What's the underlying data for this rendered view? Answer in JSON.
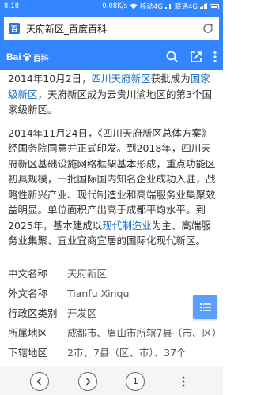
{
  "status_bar": {
    "time": "8:18",
    "speed": "0.08K/s",
    "carrier1": "移动4G",
    "carrier2": "联通4G"
  },
  "url_bar": {
    "site_icon_text": "百",
    "title": "天府新区_百度百科"
  },
  "header": {
    "logo_left": "Bai",
    "logo_right": "百科"
  },
  "article": {
    "paragraphs": [
      {
        "pre1": "2014年10月2日，",
        "link1": "四川天府新区",
        "mid1": "获批成为",
        "link2": "国家级新区",
        "post1": "，天府新区成为云贵川渝地区的第3个国家级新区。"
      },
      {
        "pre1": "2014年11月24日，《四川天府新区总体方案》经国务院同意并正式印发。到2018年，四川天府新区基础设施网络框架基本形成，重点功能区初具规模，一批国际国内知名企业成功入驻，战略性新兴产业、现代制造业和高端服务业集聚效益明显。单位面积产出高于成都平均水平。到2025年，基本建成以",
        "link1": "现代制造业",
        "post1": "为主、高端服务业集聚、宜业宜商宜居的国际化现代新区。"
      }
    ],
    "info": [
      {
        "key": "中文名称",
        "value": "天府新区"
      },
      {
        "key": "外文名称",
        "value": "Tianfu Xinqu"
      },
      {
        "key": "行政区类别",
        "value": "开发区"
      },
      {
        "key": "所属地区",
        "value": "成都市、眉山市所辖7县（市、区）"
      },
      {
        "key": "下辖地区",
        "value": "2市、7县（区、市）、37个"
      }
    ]
  },
  "bottom_bar": {
    "tab_count": "1"
  },
  "colors": {
    "brand_blue": "#3385ff",
    "link_blue": "#136ec2",
    "fab_blue": "#5ba0ff"
  },
  "icons": [
    "wifi-icon",
    "signal-icon",
    "battery-icon",
    "reload-icon",
    "search-icon",
    "share-icon",
    "more-icon",
    "list-icon",
    "back-icon",
    "forward-icon"
  ]
}
